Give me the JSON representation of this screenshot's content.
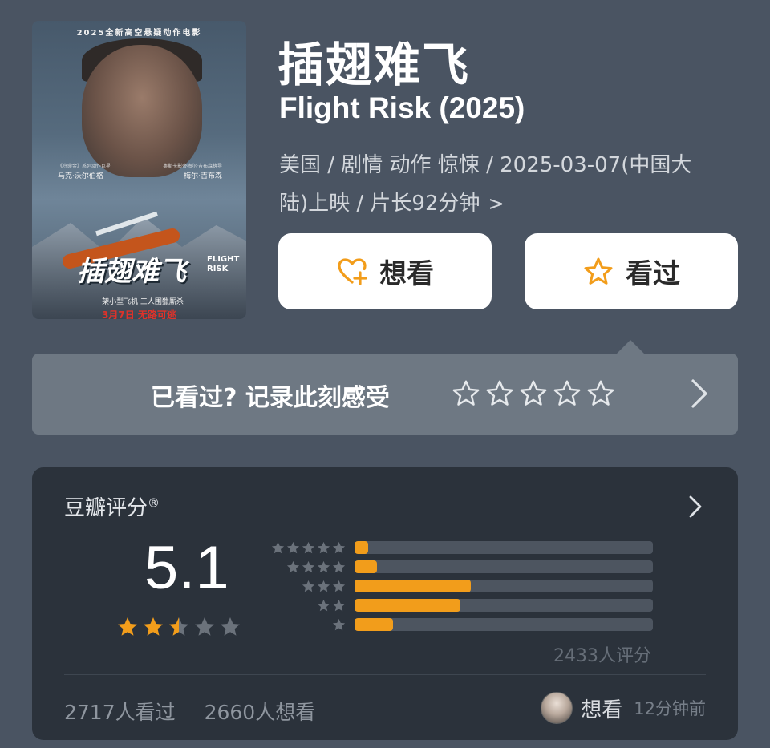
{
  "poster": {
    "top_text": "2025全新高空悬疑动作电影",
    "cast_left_note": "《夺命金》系列动作巨星",
    "cast_left": "马克·沃尔伯格",
    "cast_right_note": "奥斯卡影帝梅尔·吉布森执导",
    "cast_right": "梅尔·吉布森",
    "title": "插翅难飞",
    "title_en_1": "FLIGHT",
    "title_en_2": "RISK",
    "tagline": "一架小型飞机  三人围獵厮杀",
    "release": "3月7日 无路可逃"
  },
  "movie": {
    "title_zh": "插翅难飞",
    "title_en": "Flight Risk (2025)",
    "meta_line1": "美国 / 剧情 动作 惊悚 / 2025-03-07(中国大",
    "meta_line2": "陆)上映 / 片长92分钟",
    "meta_chevron": ">"
  },
  "buttons": {
    "want_label": "想看",
    "seen_label": "看过"
  },
  "record": {
    "prompt": "已看过? 记录此刻感受"
  },
  "rating": {
    "label": "豆瓣评分",
    "reg_mark": "®",
    "score": "5.1",
    "score_stars": 2.5,
    "distribution": [
      {
        "stars": 5,
        "percent": 4.5
      },
      {
        "stars": 4,
        "percent": 7.5
      },
      {
        "stars": 3,
        "percent": 39
      },
      {
        "stars": 2,
        "percent": 35.5
      },
      {
        "stars": 1,
        "percent": 13
      }
    ],
    "count": "2433人评分"
  },
  "stats": {
    "seen": "2717人看过",
    "want": "2660人想看"
  },
  "recent": {
    "action": "想看",
    "time": "12分钟前"
  },
  "colors": {
    "background": "#4a5462",
    "card": "#2b323b",
    "accent_orange": "#f29d1b",
    "star_gray": "#6b727b"
  }
}
